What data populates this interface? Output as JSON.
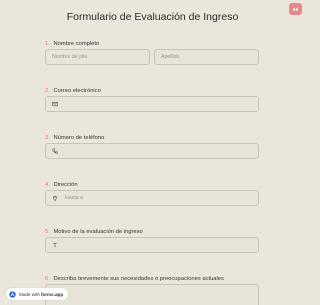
{
  "form": {
    "title": "Formulario de Evaluación de Ingreso",
    "fields": [
      {
        "num": "1.",
        "label": "Nombre completo",
        "first_placeholder": "Nombre de pila",
        "last_placeholder": "Apellido"
      },
      {
        "num": "2.",
        "label": "Correo electrónico",
        "icon": "mail-icon"
      },
      {
        "num": "3.",
        "label": "Número de teléfono",
        "icon": "phone-icon"
      },
      {
        "num": "4.",
        "label": "Dirección",
        "icon": "location-pin-icon",
        "placeholder": "Hasta a"
      },
      {
        "num": "5.",
        "label": "Motivo de la evaluación de ingreso",
        "icon": "text-icon"
      },
      {
        "num": "6.",
        "label": "Describa brevemente sus necesidades o preocupaciones actuales"
      }
    ]
  },
  "badge": {
    "prefix": "Made with",
    "brand": "forms.app"
  },
  "colors": {
    "background": "#ebe6dc",
    "accent": "#e07b6a",
    "corner_button": "#e4898a"
  }
}
